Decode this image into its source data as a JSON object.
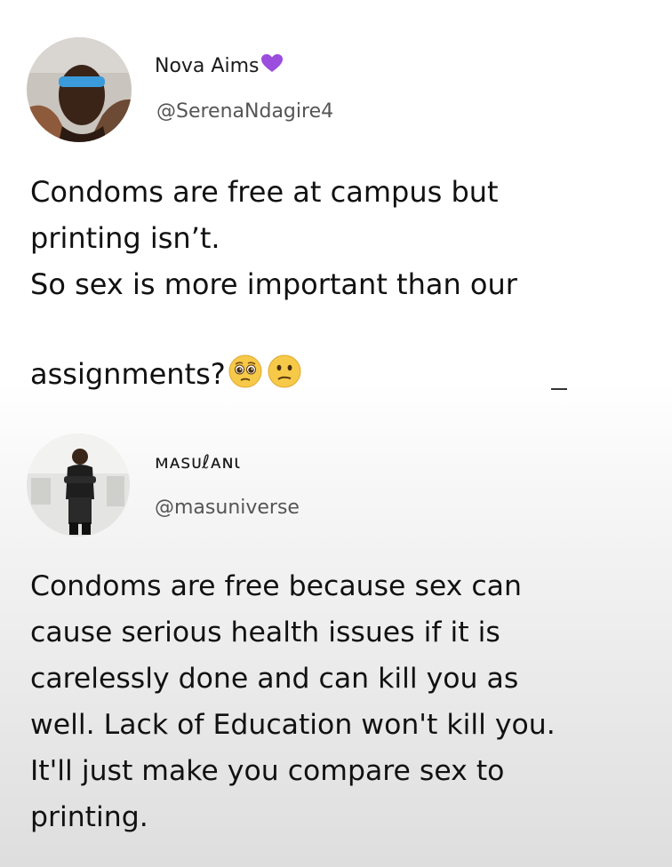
{
  "tweet1": {
    "author_name": "Nova Aims",
    "name_icon": "purple-heart-icon",
    "handle": "@SerenaNdagire4",
    "text": "Condoms are free at campus but\nprinting isn’t.\nSo sex is more important than our\nassignments?",
    "emojis": [
      "pleading-face-icon",
      "confused-face-icon"
    ]
  },
  "tweet2": {
    "author_name": "ᴍᴀsᴜℓᴀɴι",
    "handle": "@masuniverse",
    "text": "Condoms are free because sex can\ncause serious health issues if it is\ncarelessly done and can kill you as\nwell. Lack of Education won't kill you.\nIt'll just make you compare sex to\nprinting."
  },
  "colors": {
    "heart": "#9b4dde",
    "emoji_yellow": "#f7c948",
    "handle_gray": "#555555"
  }
}
